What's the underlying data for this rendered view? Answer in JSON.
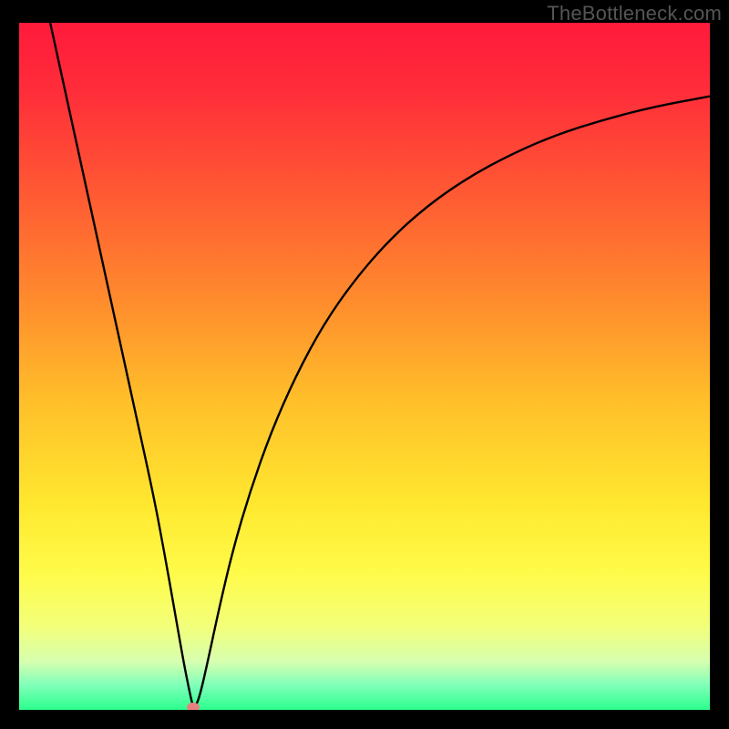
{
  "attribution": "TheBottleneck.com",
  "chart_data": {
    "type": "line",
    "title": "",
    "xlabel": "",
    "ylabel": "",
    "xlim": [
      0,
      100
    ],
    "ylim": [
      0,
      100
    ],
    "background_gradient": {
      "stops": [
        {
          "offset": 0.0,
          "color": "#ff1a3b"
        },
        {
          "offset": 0.1,
          "color": "#ff2d3a"
        },
        {
          "offset": 0.25,
          "color": "#ff5a33"
        },
        {
          "offset": 0.4,
          "color": "#ff8a2d"
        },
        {
          "offset": 0.55,
          "color": "#ffbf2a"
        },
        {
          "offset": 0.7,
          "color": "#ffe82f"
        },
        {
          "offset": 0.8,
          "color": "#fffb49"
        },
        {
          "offset": 0.88,
          "color": "#f2ff7a"
        },
        {
          "offset": 0.93,
          "color": "#d6ffb0"
        },
        {
          "offset": 0.965,
          "color": "#7dffb8"
        },
        {
          "offset": 1.0,
          "color": "#2bff8d"
        }
      ]
    },
    "series": [
      {
        "name": "bottleneck-curve",
        "points": [
          {
            "x": 4.5,
            "y": 100.0
          },
          {
            "x": 7.0,
            "y": 88.5
          },
          {
            "x": 9.5,
            "y": 77.0
          },
          {
            "x": 12.0,
            "y": 65.5
          },
          {
            "x": 14.5,
            "y": 54.0
          },
          {
            "x": 17.0,
            "y": 42.5
          },
          {
            "x": 19.5,
            "y": 31.0
          },
          {
            "x": 21.0,
            "y": 23.0
          },
          {
            "x": 22.5,
            "y": 14.5
          },
          {
            "x": 23.8,
            "y": 7.0
          },
          {
            "x": 24.8,
            "y": 2.0
          },
          {
            "x": 25.2,
            "y": 0.4
          },
          {
            "x": 25.6,
            "y": 0.6
          },
          {
            "x": 26.2,
            "y": 2.2
          },
          {
            "x": 27.3,
            "y": 7.0
          },
          {
            "x": 29.0,
            "y": 15.0
          },
          {
            "x": 31.0,
            "y": 23.5
          },
          {
            "x": 33.5,
            "y": 32.0
          },
          {
            "x": 36.5,
            "y": 40.5
          },
          {
            "x": 40.0,
            "y": 48.5
          },
          {
            "x": 44.0,
            "y": 56.0
          },
          {
            "x": 48.5,
            "y": 62.5
          },
          {
            "x": 53.5,
            "y": 68.3
          },
          {
            "x": 59.0,
            "y": 73.3
          },
          {
            "x": 65.0,
            "y": 77.5
          },
          {
            "x": 71.5,
            "y": 81.0
          },
          {
            "x": 78.0,
            "y": 83.8
          },
          {
            "x": 85.0,
            "y": 86.0
          },
          {
            "x": 92.0,
            "y": 87.8
          },
          {
            "x": 100.0,
            "y": 89.3
          }
        ]
      }
    ],
    "marker": {
      "x": 25.2,
      "y": 0.4,
      "color": "#e98080"
    }
  }
}
